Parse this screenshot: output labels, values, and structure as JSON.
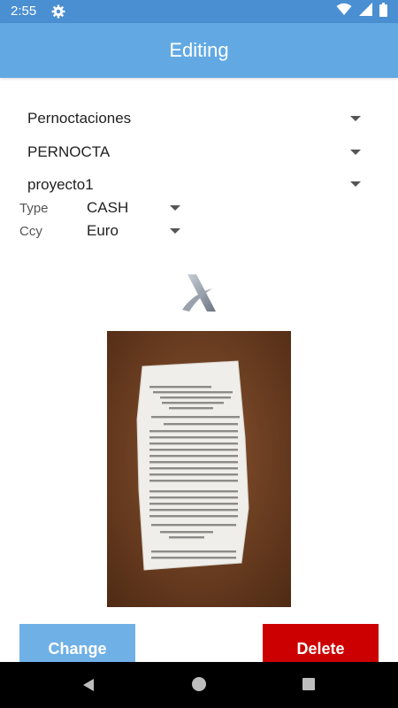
{
  "status_bar": {
    "time": "2:55",
    "icons": [
      "gear-icon",
      "wifi-icon",
      "signal-icon",
      "battery-icon"
    ]
  },
  "app_bar": {
    "title": "Editing"
  },
  "form": {
    "category": {
      "value": "Pernoctaciones"
    },
    "subcategory": {
      "value": "PERNOCTA"
    },
    "project": {
      "value": "proyecto1"
    },
    "type": {
      "label": "Type",
      "value": "CASH"
    },
    "currency": {
      "label": "Ccy",
      "value": "Euro"
    }
  },
  "logo": {
    "icon": "brand-x-logo"
  },
  "receipt_image": {
    "icon": "receipt-photo"
  },
  "actions": {
    "change_label": "Change",
    "delete_label": "Delete"
  },
  "nav_bar": {
    "icons": [
      "back-icon",
      "home-icon",
      "recents-icon"
    ]
  },
  "colors": {
    "status_bar": "#4a8fd2",
    "app_bar": "#62a9e3",
    "change_button": "#6fb0e6",
    "delete_button": "#cc0000"
  }
}
